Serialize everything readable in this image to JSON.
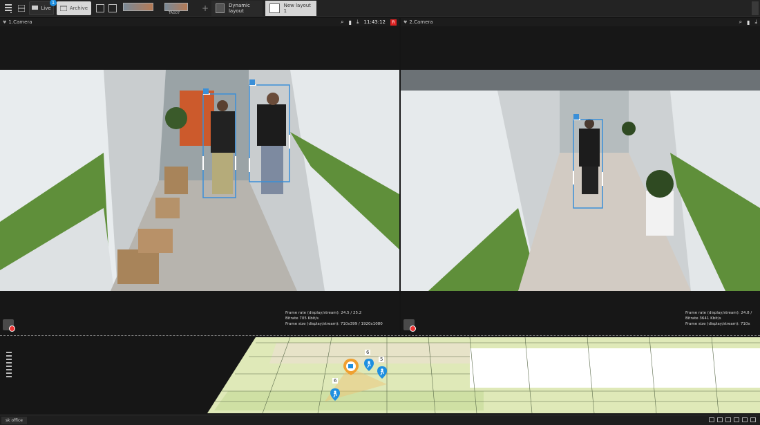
{
  "toolbar": {
    "live_label": "Live",
    "live_badge": "1",
    "archive_label": "Archive",
    "thumb_tag": "TAG07",
    "add_tab": "+",
    "tabs": [
      {
        "label": "Dynamic layout"
      },
      {
        "label": "New layout 1"
      }
    ]
  },
  "cameras": [
    {
      "title": "1.Camera",
      "time": "11:43:12",
      "rec": "R",
      "stats": {
        "frame_rate": "Frame rate (display/stream): 24.5 / 25.2",
        "bitrate": "Bitrate 705 Kbit/s",
        "frame_size": "Frame size (display/stream): 710x399 / 1920x1080"
      }
    },
    {
      "title": "2.Camera",
      "stats": {
        "frame_rate": "Frame rate (display/stream): 24.8 /",
        "bitrate": "Bitrate 3641 Kbit/s",
        "frame_size": "Frame size (display/stream): 710x"
      }
    }
  ],
  "map": {
    "markers": [
      {
        "type": "camera",
        "count": "6"
      },
      {
        "type": "person",
        "count": "5"
      },
      {
        "type": "person",
        "count": ""
      },
      {
        "type": "person",
        "count": "6"
      }
    ]
  },
  "bottom": {
    "map_tab": "sk office"
  },
  "colors": {
    "accent": "#1e8fe0",
    "detect_box": "#ffffff",
    "detect_edge": "#3a8fd8",
    "rec": "#dd2222",
    "map_green": "#dfe9b8"
  }
}
